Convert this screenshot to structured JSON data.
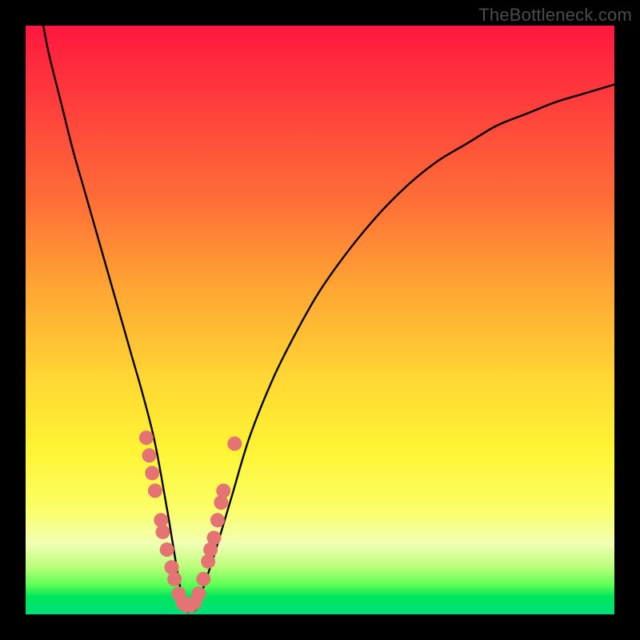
{
  "watermark": "TheBottleneck.com",
  "colors": {
    "frame": "#000000",
    "curve": "#000000",
    "marker_fill": "#e57373",
    "marker_stroke": "#d46a6a"
  },
  "chart_data": {
    "type": "line",
    "title": "",
    "xlabel": "",
    "ylabel": "",
    "xlim": [
      0,
      100
    ],
    "ylim": [
      0,
      100
    ],
    "grid": false,
    "note": "Axes carry no tick labels; values are read off relative position as percentages of the plot area (0 = left/bottom, 100 = right/top). Curve is a V-shaped bottleneck dip reaching ~0 around x≈27.",
    "series": [
      {
        "name": "bottleneck-curve",
        "x": [
          3,
          4,
          6,
          8,
          10,
          12,
          14,
          16,
          18,
          20,
          22,
          24,
          25,
          26,
          27,
          28,
          29,
          30,
          32,
          35,
          38,
          42,
          46,
          50,
          55,
          60,
          65,
          70,
          75,
          80,
          85,
          90,
          95,
          100
        ],
        "y": [
          100,
          95,
          87,
          79,
          72,
          65,
          58,
          51,
          44,
          37,
          29,
          18,
          12,
          6,
          1,
          0.5,
          1,
          4,
          10,
          20,
          30,
          40,
          48,
          55,
          62,
          68,
          73,
          77,
          80,
          83,
          85,
          87,
          88.5,
          90
        ]
      }
    ],
    "markers": {
      "name": "highlighted-points",
      "note": "Salmon circular markers clustered on both sides of the dip in the yellow/green band (~y 3–30).",
      "points": [
        {
          "x": 20.5,
          "y": 30
        },
        {
          "x": 21,
          "y": 27
        },
        {
          "x": 21.5,
          "y": 24
        },
        {
          "x": 22,
          "y": 21
        },
        {
          "x": 23,
          "y": 16
        },
        {
          "x": 23.3,
          "y": 14
        },
        {
          "x": 24,
          "y": 11
        },
        {
          "x": 24.8,
          "y": 8
        },
        {
          "x": 25.3,
          "y": 6
        },
        {
          "x": 26,
          "y": 3.5
        },
        {
          "x": 26.7,
          "y": 2
        },
        {
          "x": 27.3,
          "y": 1.5
        },
        {
          "x": 28,
          "y": 1.5
        },
        {
          "x": 28.7,
          "y": 2
        },
        {
          "x": 29.4,
          "y": 3.5
        },
        {
          "x": 30.2,
          "y": 6
        },
        {
          "x": 31,
          "y": 9
        },
        {
          "x": 31.4,
          "y": 11
        },
        {
          "x": 32,
          "y": 13
        },
        {
          "x": 32.6,
          "y": 16
        },
        {
          "x": 33.2,
          "y": 19
        },
        {
          "x": 33.6,
          "y": 21
        },
        {
          "x": 35.5,
          "y": 29
        }
      ],
      "radius": 9
    }
  }
}
